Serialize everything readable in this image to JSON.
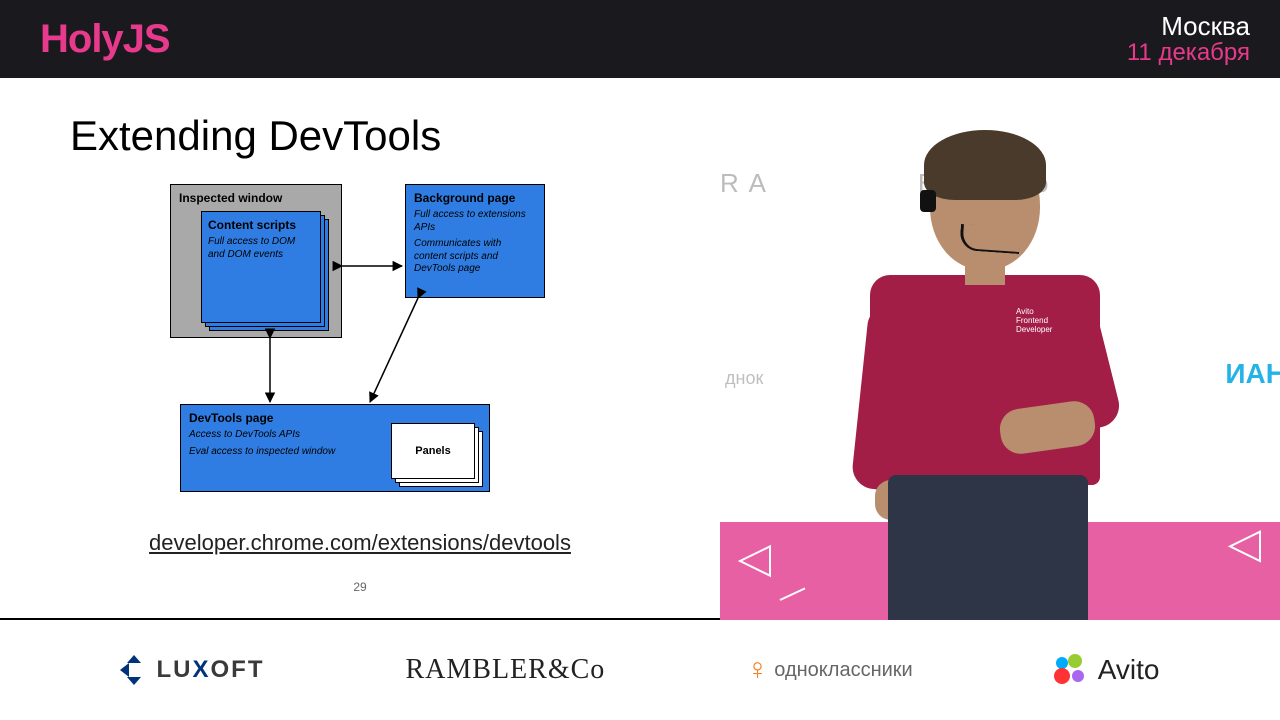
{
  "header": {
    "logo": "HolyJS",
    "city": "Москва",
    "date": "11 декабря"
  },
  "slide": {
    "title": "Extending DevTools",
    "inspected_window": "Inspected window",
    "content_scripts_title": "Content scripts",
    "content_scripts_body": "Full access to DOM and DOM events",
    "background_title": "Background page",
    "background_body1": "Full access to extensions APIs",
    "background_body2": "Communicates with content scripts and DevTools page",
    "devtools_title": "DevTools page",
    "devtools_body1": "Access to DevTools APIs",
    "devtools_body2": "Eval access to inspected window",
    "panels": "Panels",
    "link": "developer.chrome.com/extensions/devtools",
    "page_number": "29"
  },
  "stage": {
    "bg_logo1": "R A",
    "bg_logo2": "BLER&Co",
    "bg_cut": "днок",
    "bg_cyan": "ИАН",
    "badge_line1": "Avito",
    "badge_line2": "Frontend",
    "badge_line3": "Developer"
  },
  "sponsors": {
    "luxoft_pre": "LU",
    "luxoft_x": "X",
    "luxoft_post": "OFT",
    "rambler": "RAMBLER&Co",
    "ok": "одноклассники",
    "avito": "Avito"
  }
}
